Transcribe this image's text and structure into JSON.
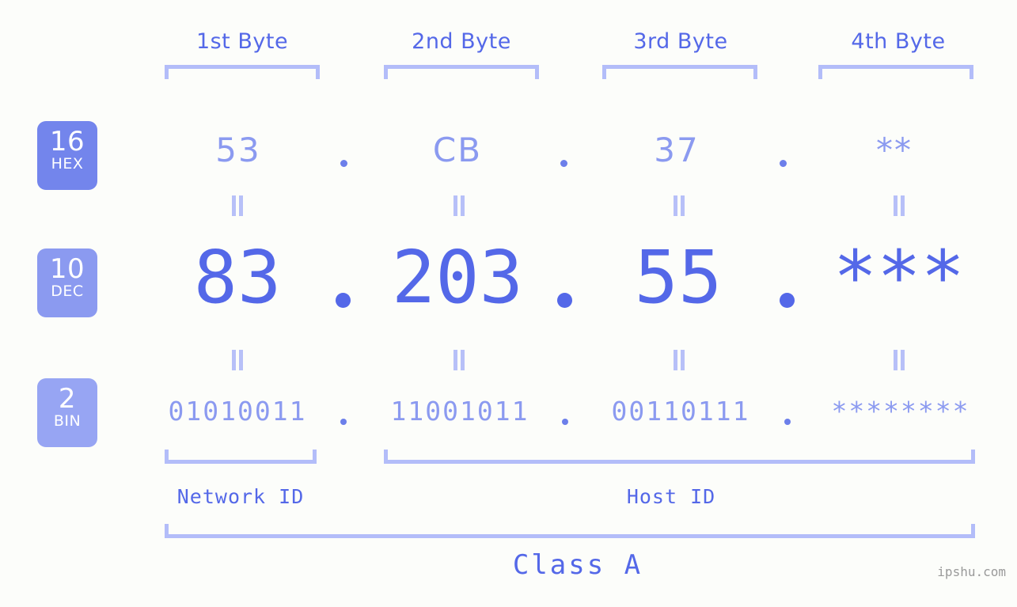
{
  "headers": [
    {
      "label": "1st Byte"
    },
    {
      "label": "2nd Byte"
    },
    {
      "label": "3rd Byte"
    },
    {
      "label": "4th Byte"
    }
  ],
  "bases": [
    {
      "num": "16",
      "abbr": "HEX",
      "color": "#7385ec"
    },
    {
      "num": "10",
      "abbr": "DEC",
      "color": "#8b9af0"
    },
    {
      "num": "2",
      "abbr": "BIN",
      "color": "#97a5f3"
    }
  ],
  "rows": {
    "hex": {
      "values": [
        "53",
        "CB",
        "37",
        "**"
      ],
      "separator": "."
    },
    "dec": {
      "values": [
        "83",
        "203",
        "55",
        "***"
      ],
      "separator": "."
    },
    "bin": {
      "values": [
        "01010011",
        "11001011",
        "00110111",
        "********"
      ],
      "separator": "."
    }
  },
  "connector": "||",
  "sections": {
    "network_id": "Network ID",
    "host_id": "Host ID",
    "class": "Class A"
  },
  "watermark": "ipshu.com",
  "colors": {
    "background": "#fcfdfa",
    "accent_strong": "#5468e8",
    "accent_mid": "#8b9af0",
    "accent_light": "#b3bdf9"
  }
}
